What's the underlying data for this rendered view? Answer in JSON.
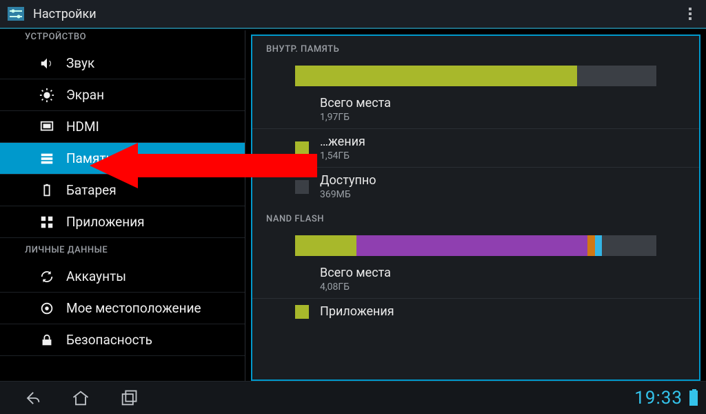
{
  "app": {
    "title": "Настройки"
  },
  "sidebar": {
    "section_device": "УСТРОЙСТВО",
    "section_personal": "ЛИЧНЫЕ ДАННЫЕ",
    "items": {
      "sound": {
        "label": "Звук"
      },
      "display": {
        "label": "Экран"
      },
      "hdmi": {
        "label": "HDMI"
      },
      "storage": {
        "label": "Память"
      },
      "battery": {
        "label": "Батарея"
      },
      "apps": {
        "label": "Приложения"
      },
      "accounts": {
        "label": "Аккаунты"
      },
      "location": {
        "label": "Мое местоположение"
      },
      "security": {
        "label": "Безопасность"
      }
    }
  },
  "main": {
    "internal": {
      "header": "ВНУТР. ПАМЯТЬ",
      "bar_segments": [
        {
          "color": "#a8b82b",
          "width_pct": 78
        },
        {
          "color": "#3b3f45",
          "width_pct": 22
        }
      ],
      "rows": {
        "total": {
          "label": "Всего места",
          "value": "1,97ГБ",
          "swatch": ""
        },
        "apps": {
          "label": "…жения",
          "value": "1,54ГБ",
          "swatch": "#a8b82b"
        },
        "available": {
          "label": "Доступно",
          "value": "369МБ",
          "swatch": "#3b3f45"
        }
      }
    },
    "nand": {
      "header": "NAND FLASH",
      "bar_segments": [
        {
          "color": "#a8b82b",
          "width_pct": 17
        },
        {
          "color": "#8f3fb0",
          "width_pct": 64
        },
        {
          "color": "#d07814",
          "width_pct": 2
        },
        {
          "color": "#33b5e5",
          "width_pct": 2
        },
        {
          "color": "#3b3f45",
          "width_pct": 15
        }
      ],
      "rows": {
        "total": {
          "label": "Всего места",
          "value": "4,08ГБ",
          "swatch": ""
        },
        "apps": {
          "label": "Приложения",
          "value": "",
          "swatch": "#a8b82b"
        }
      }
    }
  },
  "status": {
    "time": "19:33"
  }
}
